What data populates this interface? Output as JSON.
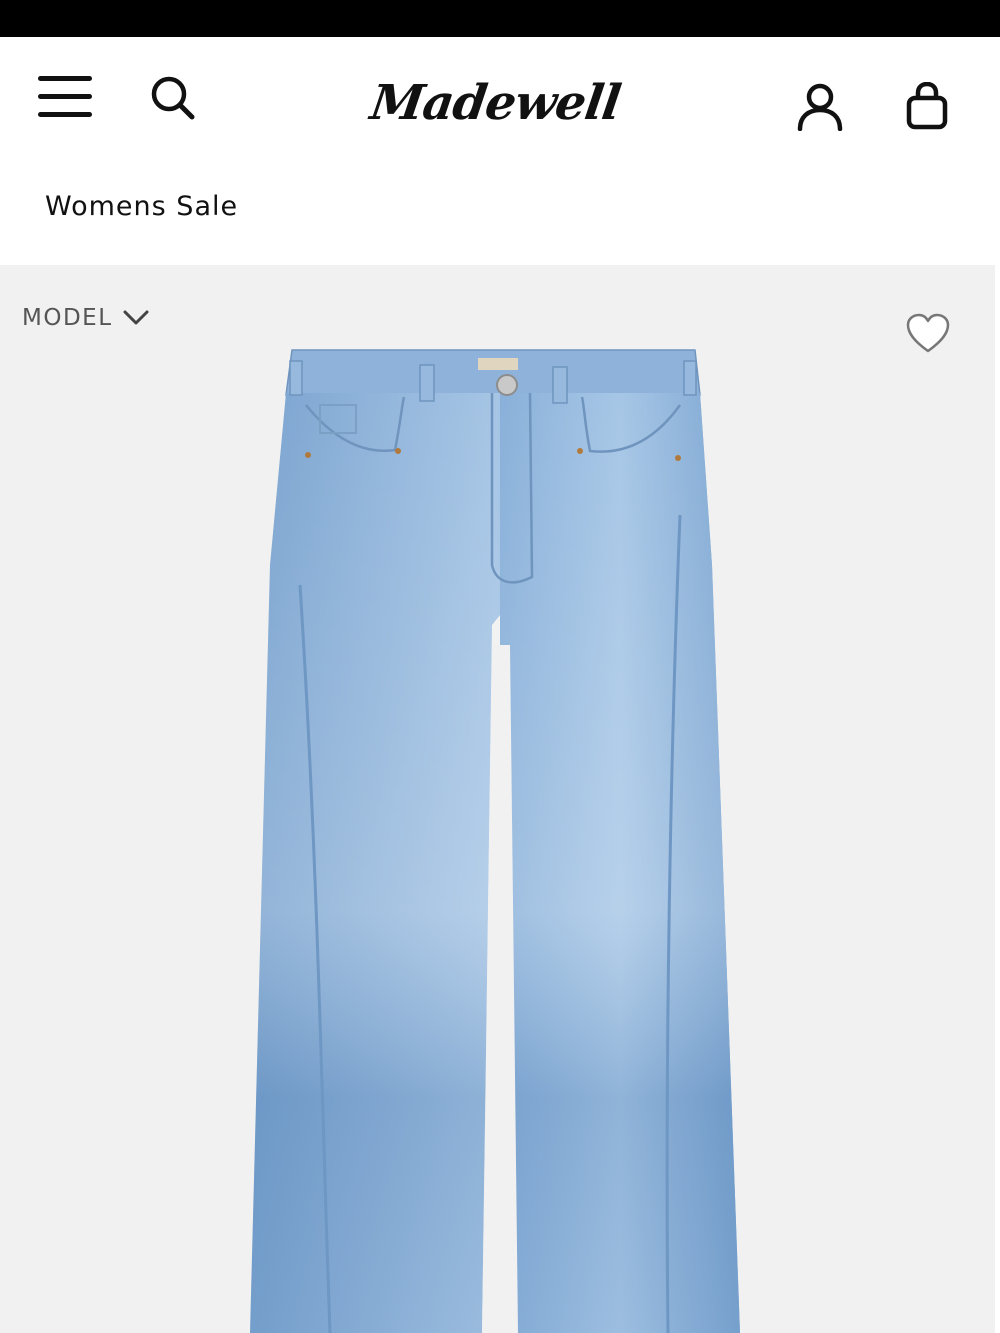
{
  "brand": {
    "logo_text": "Madewell"
  },
  "header": {
    "menu_icon": "hamburger-menu-icon",
    "search_icon": "search-icon",
    "account_icon": "account-person-icon",
    "bag_icon": "shopping-bag-icon"
  },
  "breadcrumb": {
    "label": "Womens Sale"
  },
  "product": {
    "view_toggle_label": "MODEL",
    "view_toggle_icon": "chevron-down-icon",
    "wishlist_icon": "heart-outline-icon",
    "image_subject": "jeans-product-photo"
  },
  "colors": {
    "status_bar": "#000000",
    "product_bg": "#f1f1f1",
    "denim": "#8fb4da"
  }
}
